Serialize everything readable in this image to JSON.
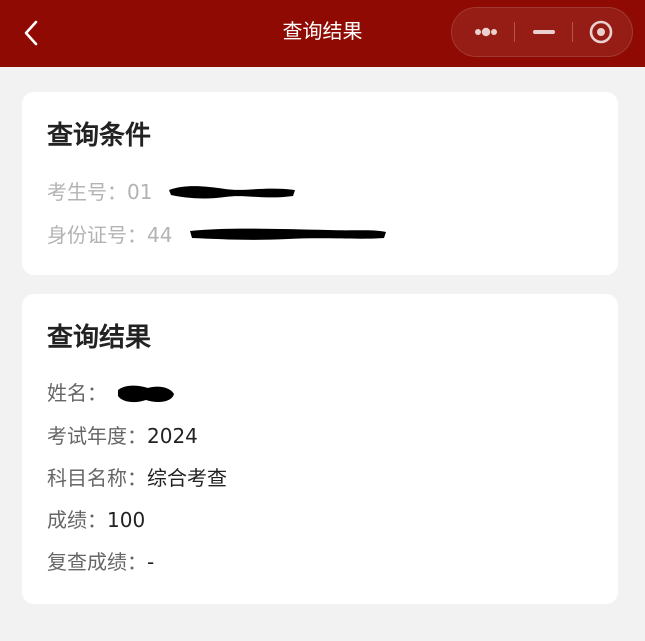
{
  "header": {
    "title": "查询结果"
  },
  "query_card": {
    "title": "查询条件",
    "exam_no_label": "考生号：",
    "exam_no_visible_prefix": "01",
    "id_label": "身份证号：",
    "id_visible_prefix": "44"
  },
  "result_card": {
    "title": "查询结果",
    "rows": [
      {
        "label": "姓名：",
        "value": ""
      },
      {
        "label": "考试年度：",
        "value": "2024"
      },
      {
        "label": "科目名称：",
        "value": "综合考查"
      },
      {
        "label": "成绩：",
        "value": "100"
      },
      {
        "label": "复查成绩：",
        "value": "-"
      }
    ]
  },
  "colors": {
    "header_bg": "#8e0a03",
    "page_bg": "#f2f2f2",
    "card_bg": "#ffffff"
  },
  "icons": [
    "chevron-left-icon",
    "more-dots-icon",
    "minimize-icon",
    "close-target-icon"
  ]
}
